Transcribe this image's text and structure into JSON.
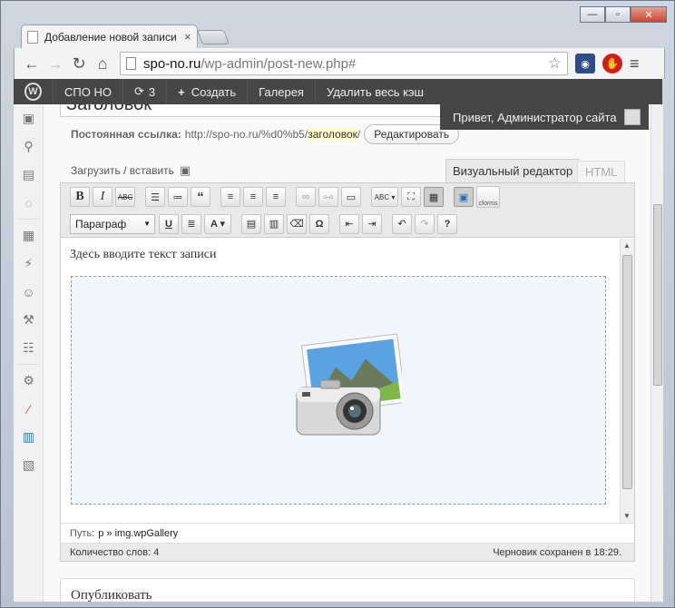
{
  "browser": {
    "tab_title": "Добавление новой записи",
    "url_host": "spo-no.ru",
    "url_path": "/wp-admin/post-new.php#"
  },
  "adminbar": {
    "site_name": "СПО НО",
    "updates_count": "3",
    "create_label": "Создать",
    "gallery_label": "Галерея",
    "clear_cache_label": "Удалить весь кэш",
    "greeting": "Привет, Администратор сайта"
  },
  "post": {
    "title_value": "Заголовок",
    "permalink_label": "Постоянная ссылка:",
    "permalink_base": "http://spo-no.ru/%d0%b5/",
    "permalink_slug": "заголовок",
    "permalink_suffix": "/",
    "edit_button": "Редактировать",
    "upload_label": "Загрузить / вставить"
  },
  "editor": {
    "tab_visual": "Визуальный редактор",
    "tab_html": "HTML",
    "format_select": "Параграф",
    "cforms_label": "cforms",
    "body_text": "Здесь вводите текст записи",
    "path_label": "Путь:",
    "path_value": "p » img.wpGallery",
    "word_count": "Количество слов: 4",
    "saved_status": "Черновик сохранен в 18:29."
  },
  "publish": {
    "title": "Опубликовать"
  },
  "colors": {
    "adminbar_bg": "#464646",
    "gallery_bg": "#f1f6fb",
    "slug_highlight": "#fffbcc"
  }
}
